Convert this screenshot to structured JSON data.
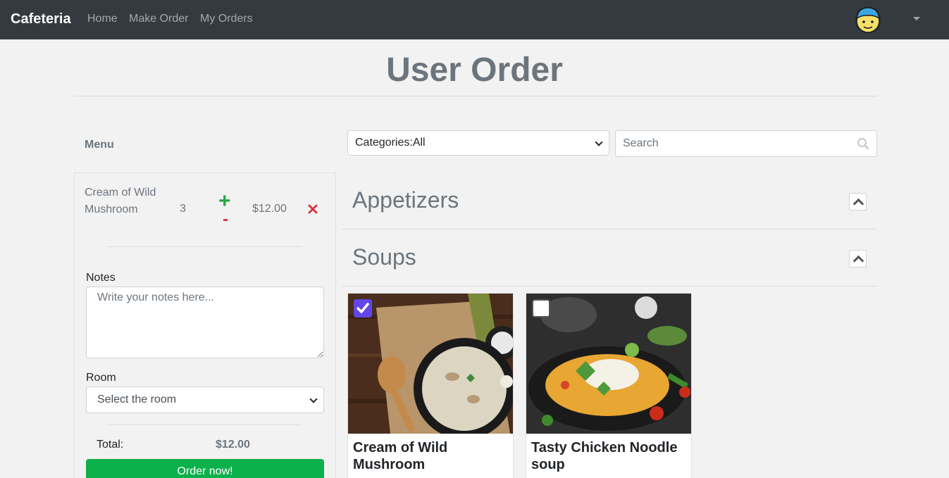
{
  "navbar": {
    "brand": "Cafeteria",
    "links": [
      "Home",
      "Make Order",
      "My Orders"
    ]
  },
  "page": {
    "title": "User Order"
  },
  "sidebar": {
    "menu_label": "Menu",
    "cart_items": [
      {
        "name": "Cream of Wild Mushroom",
        "qty": "3",
        "plus": "+",
        "minus": "-",
        "price": "$12.00"
      }
    ],
    "notes_label": "Notes",
    "notes_placeholder": "Write your notes here...",
    "room_label": "Room",
    "room_selected": "Select the room",
    "total_label": "Total:",
    "total_value": "$12.00",
    "order_button": "Order now!"
  },
  "filters": {
    "category_selected": "Categories:All",
    "search_placeholder": "Search"
  },
  "categories": [
    {
      "title": "Appetizers"
    },
    {
      "title": "Soups"
    }
  ],
  "products": [
    {
      "name": "Cream of Wild Mushroom",
      "checked": true
    },
    {
      "name": "Tasty Chicken Noodle soup",
      "checked": false
    }
  ],
  "colors": {
    "navbar": "#343a40",
    "order_button": "#0db14b",
    "checkbox_checked": "#6246ea",
    "plus": "#28a745",
    "minus": "#dc3545"
  },
  "icons": [
    "avatar-icon",
    "caret-down-icon",
    "plus-icon",
    "minus-icon",
    "remove-icon",
    "chevron-down-icon",
    "search-icon",
    "chevron-up-icon",
    "check-icon"
  ]
}
